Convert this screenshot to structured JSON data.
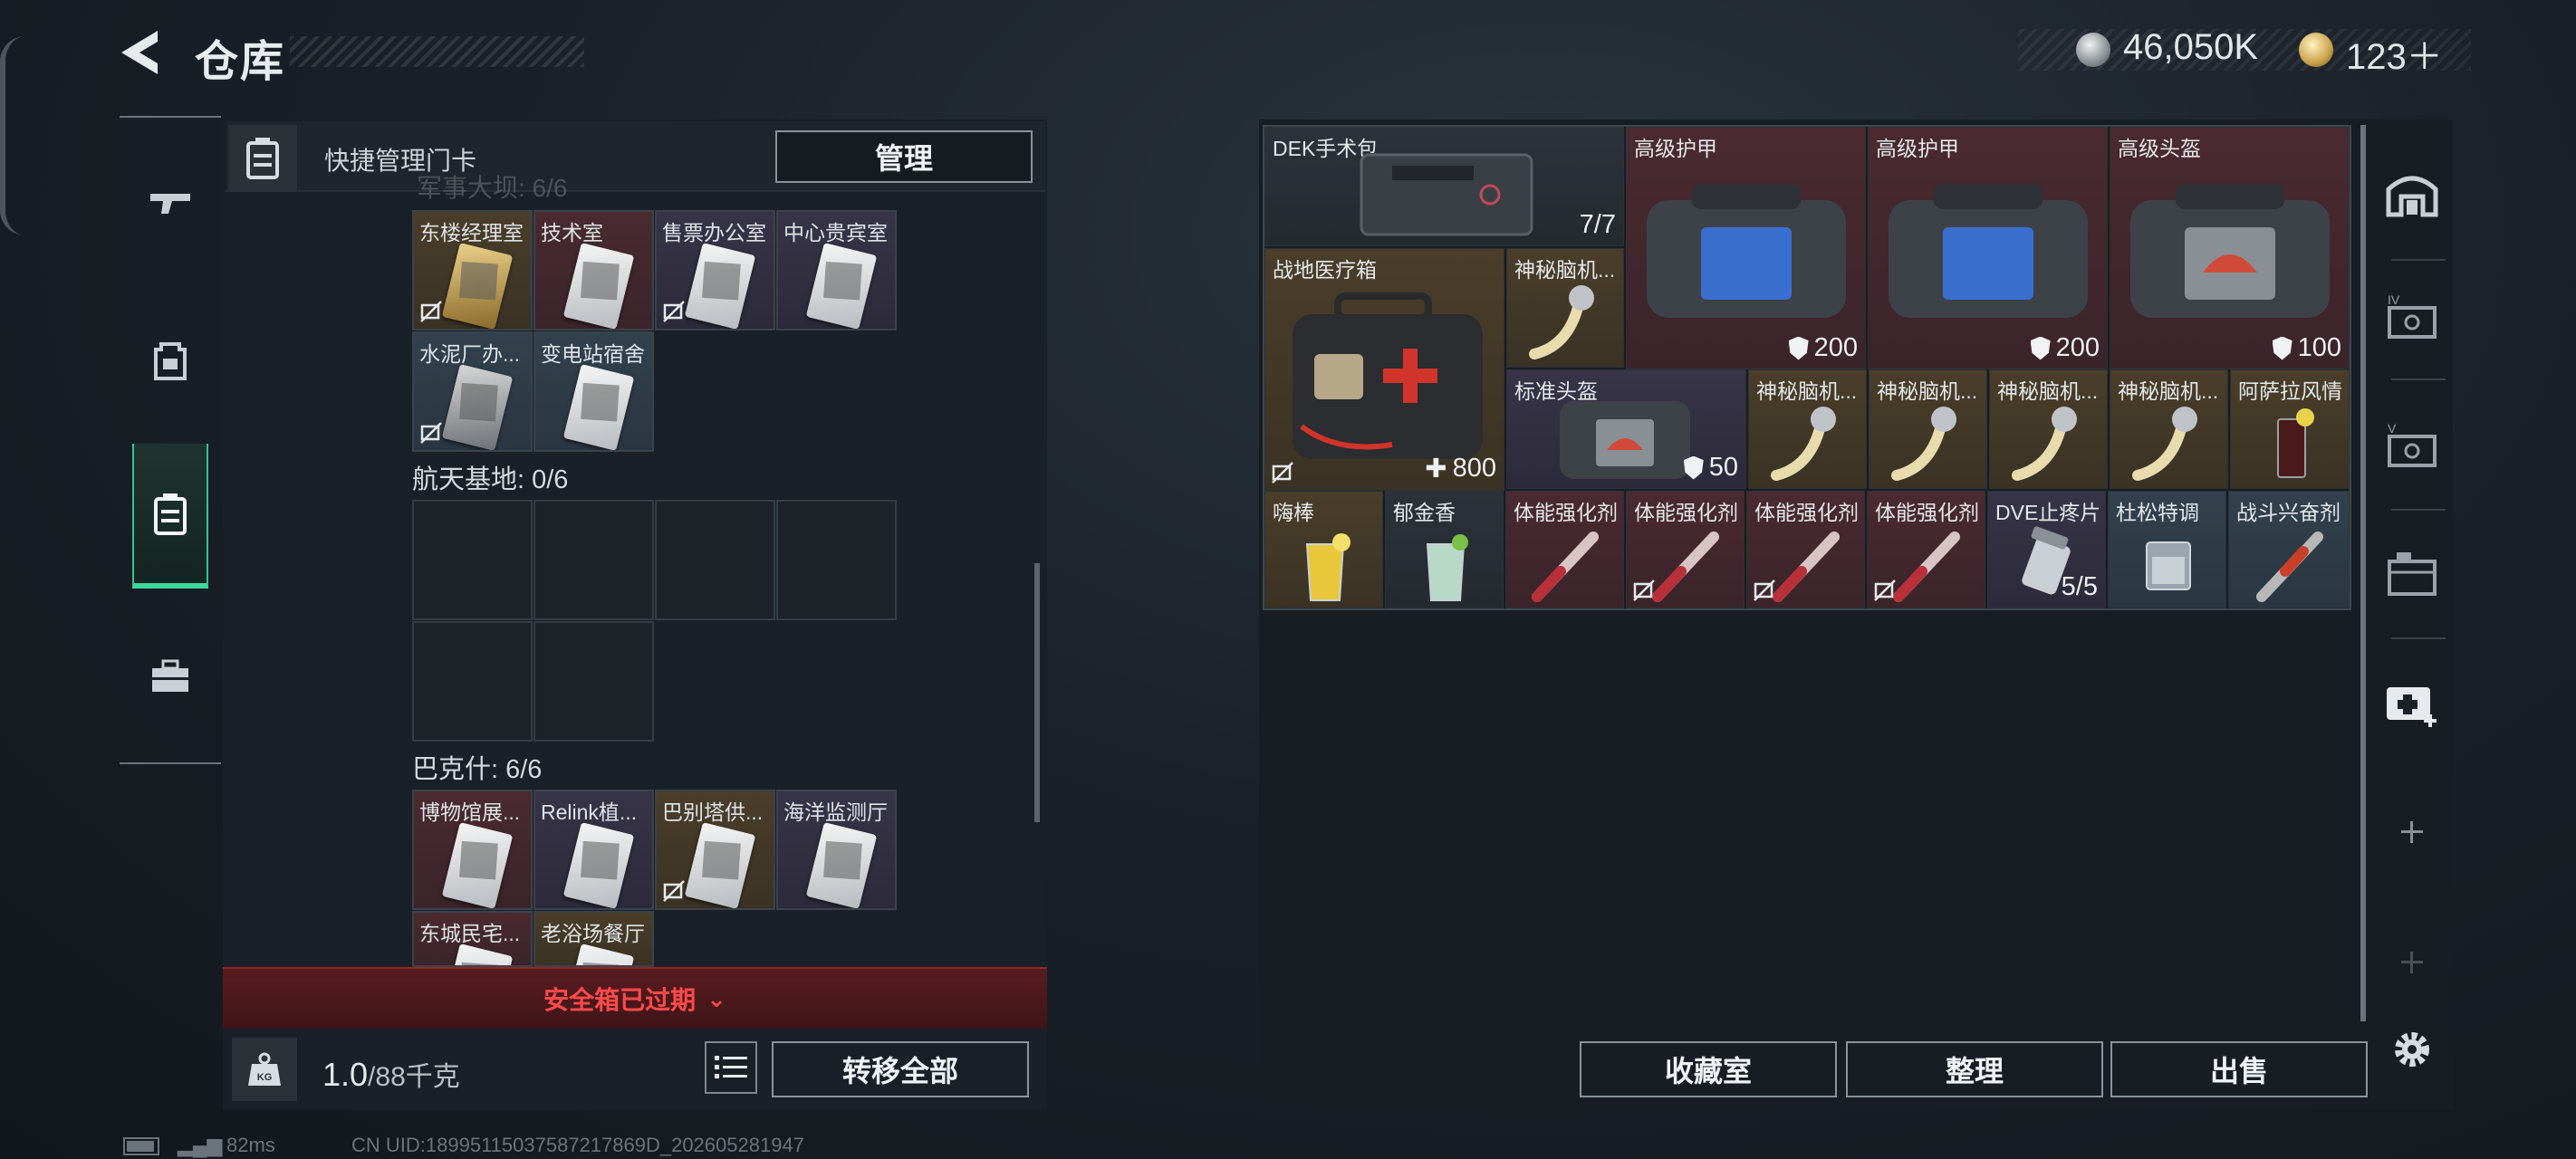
{
  "header": {
    "title": "仓库",
    "currency_silver": "46,050K",
    "currency_gold": "123＋"
  },
  "left_panel": {
    "title": "快捷管理门卡",
    "manage_label": "管理",
    "ghost_section": "军事大坝: 6/6",
    "section1_cards": [
      {
        "label": "东楼经理室"
      },
      {
        "label": "技术室"
      },
      {
        "label": "售票办公室"
      },
      {
        "label": "中心贵宾室"
      },
      {
        "label": "水泥厂办..."
      },
      {
        "label": "变电站宿舍"
      }
    ],
    "section2": {
      "label": "航天基地: 0/6"
    },
    "section3": {
      "label": "巴克什: 6/6"
    },
    "section3_cards": [
      {
        "label": "博物馆展..."
      },
      {
        "label": "Relink植..."
      },
      {
        "label": "巴别塔供..."
      },
      {
        "label": "海洋监测厅"
      },
      {
        "label": "东城民宅..."
      },
      {
        "label": "老浴场餐厅"
      }
    ],
    "expired_text": "安全箱已过期",
    "weight_value": "1.0",
    "weight_unit": "/88千克",
    "transfer_label": "转移全部"
  },
  "stash": {
    "items": [
      {
        "label": "DEK手术包",
        "count": "7/7"
      },
      {
        "label": "高级护甲",
        "durability": "200"
      },
      {
        "label": "高级护甲",
        "durability": "200"
      },
      {
        "label": "高级头盔",
        "durability": "100"
      },
      {
        "label": "战地医疗箱",
        "count": "800"
      },
      {
        "label": "神秘脑机..."
      },
      {
        "label": "标准头盔",
        "durability": "50"
      },
      {
        "label": "神秘脑机..."
      },
      {
        "label": "神秘脑机..."
      },
      {
        "label": "神秘脑机..."
      },
      {
        "label": "神秘脑机..."
      },
      {
        "label": "阿萨拉风情"
      },
      {
        "label": "嗨棒"
      },
      {
        "label": "郁金香"
      },
      {
        "label": "体能强化剂"
      },
      {
        "label": "体能强化剂"
      },
      {
        "label": "体能强化剂"
      },
      {
        "label": "体能强化剂"
      },
      {
        "label": "DVE止疼片",
        "count": "5/5"
      },
      {
        "label": "杜松特调"
      },
      {
        "label": "战斗兴奋剂"
      }
    ]
  },
  "buttons": {
    "collection": "收藏室",
    "sort": "整理",
    "sell": "出售"
  },
  "footer": {
    "ping": "82ms",
    "uid": "CN UID:18995115037587217869D_202605281947"
  },
  "colors": {
    "accent_green": "#3bd79c",
    "expired_red": "#ff4a4a",
    "rarity_red": "#4a2a30",
    "rarity_gold": "#4a3e2a",
    "rarity_purple": "#383448",
    "rarity_blue": "#33414e"
  }
}
